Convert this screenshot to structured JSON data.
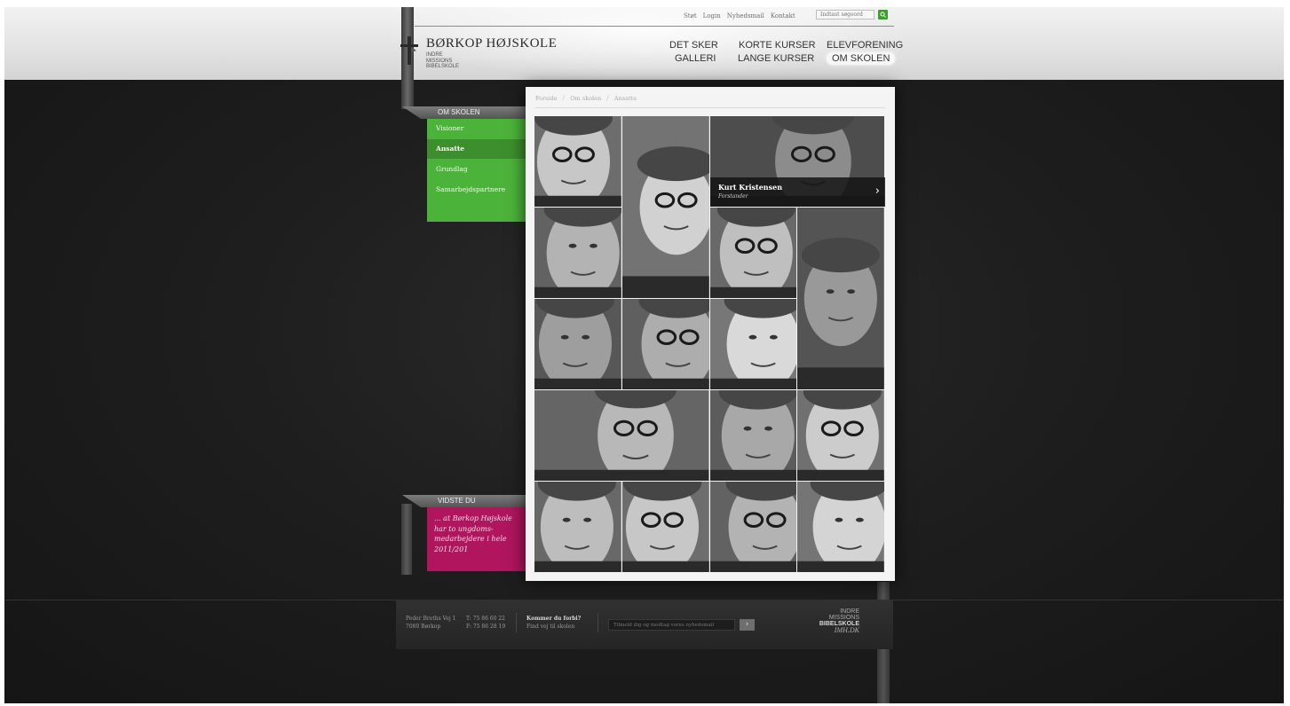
{
  "utility_nav": [
    "Støt",
    "Login",
    "Nyhedsmail",
    "Kontakt"
  ],
  "search": {
    "placeholder": "Indtast søgeord"
  },
  "logo": {
    "title": "BØRKOP HØJSKOLE",
    "subtitle_lines": [
      "INDRE",
      "MISSIONS",
      "BIBELSKOLE"
    ]
  },
  "main_nav": {
    "det_sker": "DET SKER",
    "galleri": "GALLERI",
    "korte_kurser": "KORTE KURSER",
    "lange_kurser": "LANGE KURSER",
    "elevforening": "ELEVFORENING",
    "om_skolen": "OM SKOLEN"
  },
  "side_menu": {
    "heading": "OM SKOLEN",
    "items": [
      "Visioner",
      "Ansatte",
      "Grundlag",
      "Samarbejdspartnere"
    ],
    "active_index": 1
  },
  "breadcrumb": [
    "Forside",
    "Om skolen",
    "Ansatte"
  ],
  "featured": {
    "name": "Kurt Kristensen",
    "role": "Forstander"
  },
  "did_you_know": {
    "heading": "VIDSTE DU",
    "lines": [
      "... at Børkop Højskole",
      "har to ungdoms-",
      "medarbejdere i hele",
      "2011/201"
    ]
  },
  "footer": {
    "address_line1": "Peder Breths Vej 1",
    "address_line2": "7080 Børkop",
    "phone": "T: 75 86 60 22",
    "fax": "F: 75 86 28 19",
    "visit_title": "Kommer du forbi?",
    "visit_link": "Find vej til skolen",
    "newsletter_placeholder": "Tilmeld dig og modtag vores nyhedsmail",
    "newsletter_button": "›",
    "partner_logo_lines": [
      "INDRE",
      "MISSIONS",
      "BIBELSKOLE",
      "IMH.DK"
    ]
  },
  "colors": {
    "green": "#4cb33a",
    "green_active": "#3d8f2d",
    "magenta": "#b0155e",
    "dark_bg": "#1c1c1c"
  }
}
